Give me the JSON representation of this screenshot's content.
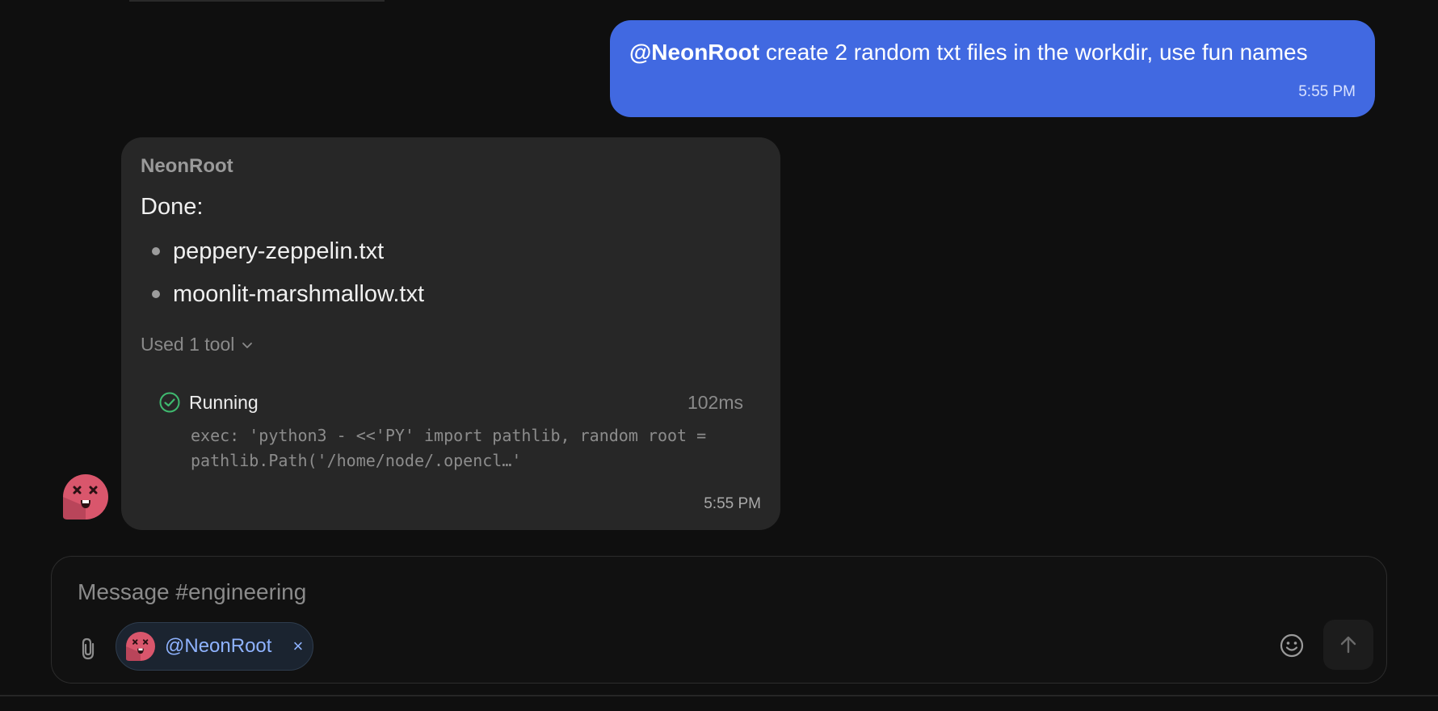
{
  "user_message": {
    "mention": "@NeonRoot",
    "text": " create 2 random txt files in the workdir, use fun names",
    "time": "5:55 PM"
  },
  "bot_message": {
    "name": "NeonRoot",
    "intro": "Done:",
    "files": [
      "peppery-zeppelin.txt",
      "moonlit-marshmallow.txt"
    ],
    "tools_summary": "Used 1 tool",
    "tool": {
      "status": "Running",
      "duration": "102ms",
      "command": "exec: 'python3 - <<'PY' import pathlib, random root = pathlib.Path('/home/node/.opencl…'"
    },
    "time": "5:55 PM"
  },
  "composer": {
    "placeholder": "Message #engineering",
    "mention_chip": "@NeonRoot",
    "chip_remove": "×"
  },
  "colors": {
    "user_bubble": "#4169e1",
    "bot_bubble": "#272727",
    "avatar": "#d9566c",
    "success": "#3fb96f"
  }
}
